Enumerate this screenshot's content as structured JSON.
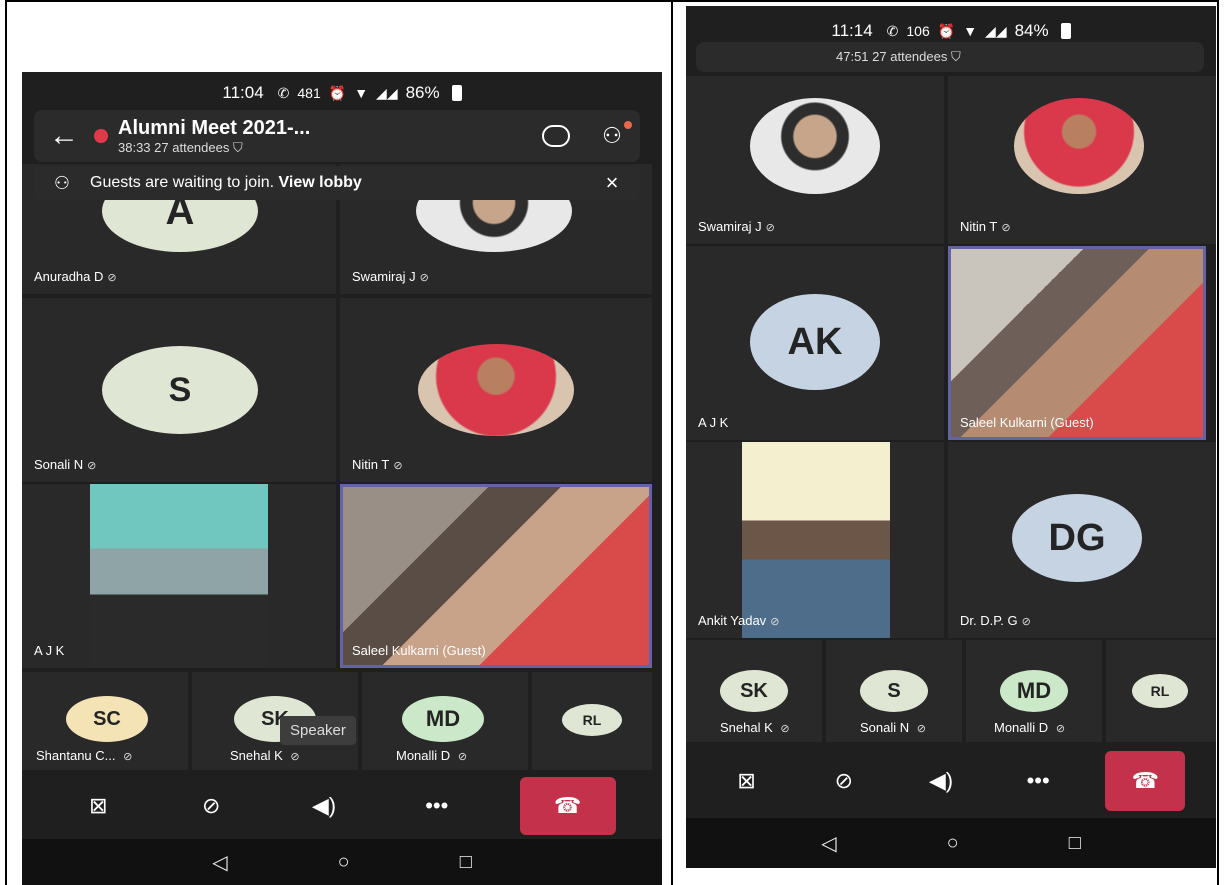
{
  "left": {
    "status": {
      "time": "11:04",
      "speed": "481",
      "battery": "86%"
    },
    "meeting": {
      "title": "Alumni Meet 2021-...",
      "duration": "38:33",
      "attendees": "27 attendees"
    },
    "lobby": {
      "text": "Guests are waiting to join.",
      "link": "View lobby"
    },
    "tiles": [
      {
        "initials": "A",
        "name": "Anuradha D",
        "color": "#dfe6d3"
      },
      {
        "name": "Swamiraj J"
      },
      {
        "initials": "S",
        "name": "Sonali N",
        "color": "#dfe6d3"
      },
      {
        "name": "Nitin T"
      },
      {
        "name": "A J K"
      },
      {
        "name": "Saleel Kulkarni (Guest)"
      }
    ],
    "small": [
      {
        "initials": "SC",
        "name": "Shantanu C...",
        "color": "#f3e3b5"
      },
      {
        "initials": "SK",
        "name": "Snehal K",
        "color": "#dfe6d3"
      },
      {
        "initials": "MD",
        "name": "Monalli D",
        "color": "#cbe8c8"
      },
      {
        "initials": "RL",
        "name": "",
        "color": "#dfe6d3"
      }
    ],
    "tooltip": "Speaker"
  },
  "right": {
    "status": {
      "time": "11:14",
      "speed": "106",
      "battery": "84%"
    },
    "meeting": {
      "duration": "47:51",
      "attendees": "27 attendees"
    },
    "tiles": [
      {
        "name": "Swamiraj J"
      },
      {
        "name": "Nitin T"
      },
      {
        "initials": "AK",
        "name": "A J K",
        "color": "#c5d3e3"
      },
      {
        "name": "Saleel Kulkarni (Guest)"
      },
      {
        "name": "Ankit Yadav"
      },
      {
        "initials": "DG",
        "name": "Dr. D.P. G",
        "color": "#c5d3e3"
      }
    ],
    "small": [
      {
        "initials": "SK",
        "name": "Snehal K",
        "color": "#dfe6d3"
      },
      {
        "initials": "S",
        "name": "Sonali N",
        "color": "#dfe6d3"
      },
      {
        "initials": "MD",
        "name": "Monalli D",
        "color": "#cbe8c8"
      },
      {
        "initials": "RL",
        "name": "",
        "color": "#dfe6d3"
      }
    ]
  },
  "icons": {
    "mute": "⊘",
    "back": "←",
    "close": "×",
    "camera_off": "camera-off-icon",
    "mic_off": "mic-off-icon",
    "speaker": "speaker-icon",
    "more": "•••",
    "hangup": "hangup-icon"
  }
}
